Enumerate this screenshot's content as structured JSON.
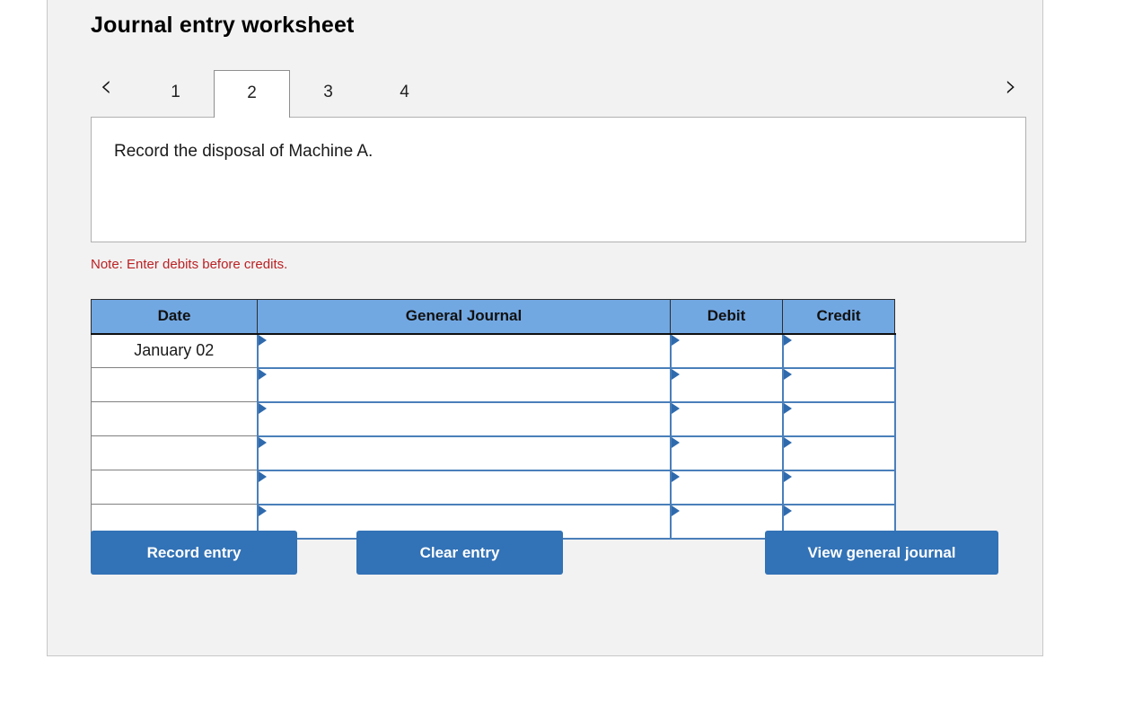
{
  "panel": {
    "title": "Journal entry worksheet"
  },
  "nav": {
    "prev_icon": "‹",
    "next_icon": "›",
    "prev_name": "chevron-left-icon",
    "next_name": "chevron-right-icon"
  },
  "tabs": [
    {
      "label": "1",
      "active": false
    },
    {
      "label": "2",
      "active": true
    },
    {
      "label": "3",
      "active": false
    },
    {
      "label": "4",
      "active": false
    }
  ],
  "prompt": {
    "text": "Record the disposal of Machine A."
  },
  "note": {
    "text": "Note: Enter debits before credits."
  },
  "table": {
    "headers": [
      "Date",
      "General Journal",
      "Debit",
      "Credit"
    ],
    "rows": [
      {
        "date": "January 02",
        "general_journal": "",
        "debit": "",
        "credit": ""
      },
      {
        "date": "",
        "general_journal": "",
        "debit": "",
        "credit": ""
      },
      {
        "date": "",
        "general_journal": "",
        "debit": "",
        "credit": ""
      },
      {
        "date": "",
        "general_journal": "",
        "debit": "",
        "credit": ""
      },
      {
        "date": "",
        "general_journal": "",
        "debit": "",
        "credit": ""
      },
      {
        "date": "",
        "general_journal": "",
        "debit": "",
        "credit": ""
      }
    ]
  },
  "buttons": {
    "record": "Record entry",
    "clear": "Clear entry",
    "view": "View general journal"
  },
  "colors": {
    "header_blue": "#72a8e2",
    "button_blue": "#3272b6",
    "note_red": "#bb2124",
    "panel_bg": "#f2f2f2",
    "cell_border_blue": "#4a7fba"
  }
}
